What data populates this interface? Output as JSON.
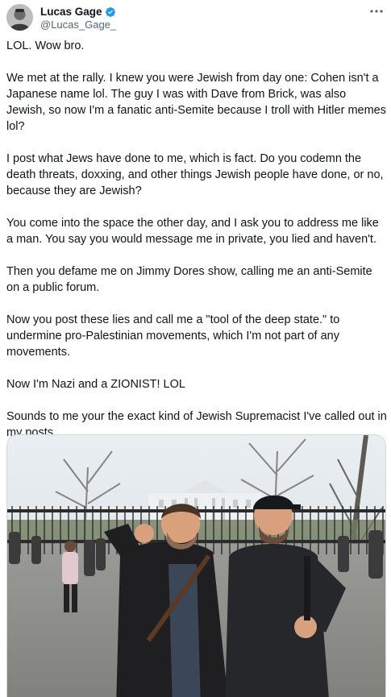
{
  "author": {
    "display_name": "Lucas Gage",
    "handle": "@Lucas_Gage_",
    "verified": true,
    "avatar_icon": "profile-photo"
  },
  "more_icon": "more-horizontal-icon",
  "tweet": {
    "paragraphs": [
      "LOL. Wow bro.",
      "We met at the rally. I knew you were Jewish from day one: Cohen isn't a Japanese name lol. The guy I was with Dave from Brick, was also Jewish, so now I'm a fanatic anti-Semite because I troll with Hitler memes lol?",
      "I post what Jews have done to me, which is fact. Do you codemn the death threats, doxxing, and other things Jewish people have done, or no, because they are Jewish?",
      "You come into the space the other day, and I ask you to address me like a man. You say you would message me in private, you lied and haven't.",
      "Then you defame me on Jimmy Dores show, calling me an anti-Semite on a public forum.",
      "Now you post these lies and call me a \"tool of the deep state.\" to undermine pro-Palestinian movements, which I'm not part of any movements.",
      "Now I'm Nazi and a ZIONIST! LOL",
      "Sounds to me your the exact kind of Jewish Supremacist I've called out in my posts."
    ]
  },
  "media": {
    "type": "photo",
    "scene": "two-men-outdoors-white-house-fence"
  },
  "colors": {
    "text": "#0f1419",
    "secondary": "#536471",
    "verified": "#1d9bf0",
    "border": "#cfd9de"
  }
}
